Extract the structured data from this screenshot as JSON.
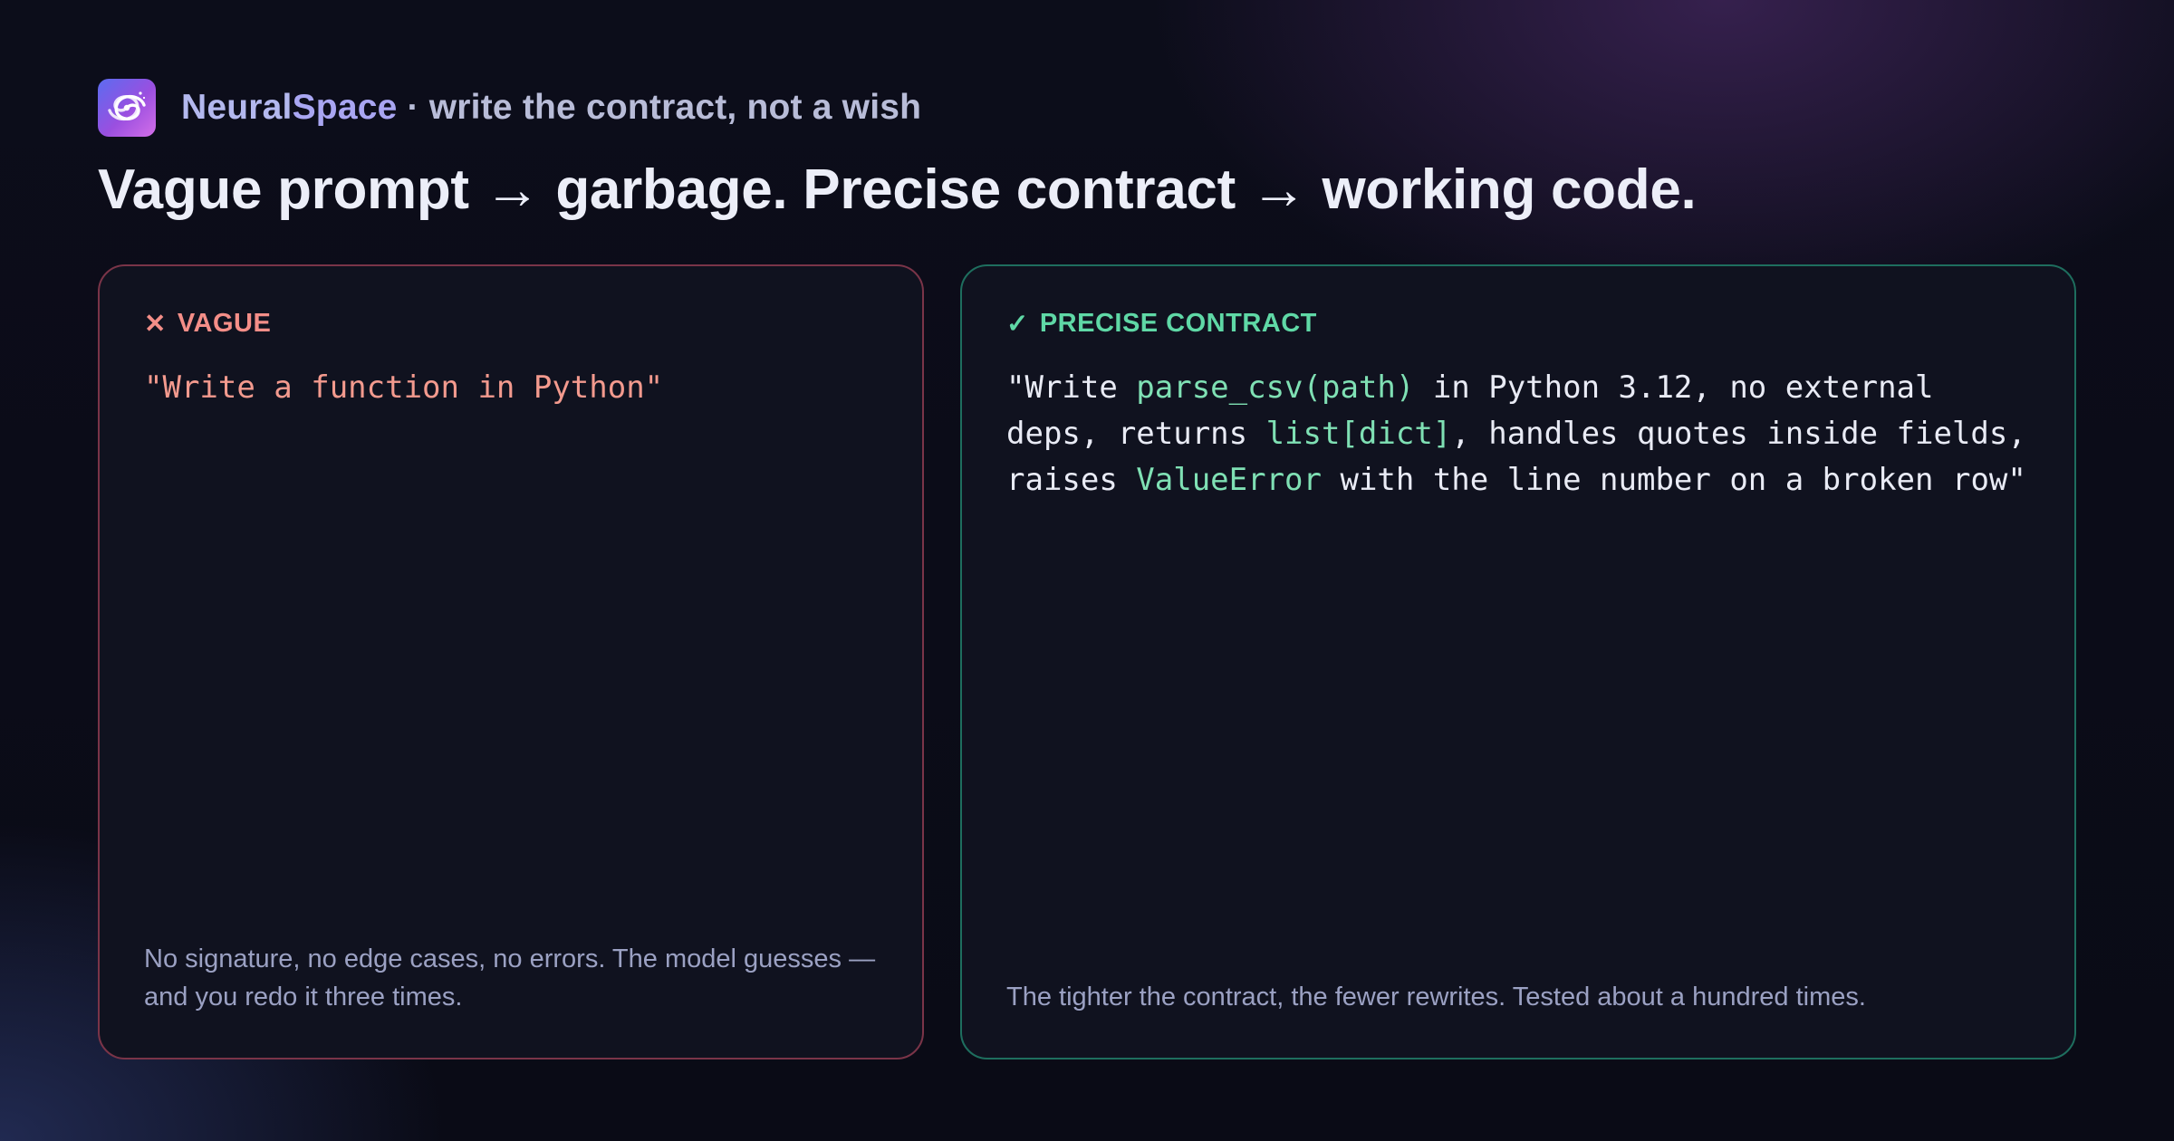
{
  "brand": {
    "name_part1": "Neural",
    "name_part2": "Space",
    "tagline": " · write the contract, not a wish",
    "logo_icon": "galaxy-swirl-icon"
  },
  "headline": "Vague prompt → garbage. Precise contract → working code.",
  "vague": {
    "mark": "✕",
    "label": "VAGUE",
    "prompt": "\"Write a function in Python\"",
    "note": "No signature, no edge cases, no errors. The model guesses — and you redo it three times.",
    "color": "#f48e88"
  },
  "precise": {
    "mark": "✓",
    "label": "PRECISE CONTRACT",
    "prompt_segments": [
      {
        "text": "\"Write ",
        "highlight": false
      },
      {
        "text": "parse_csv(path)",
        "highlight": true
      },
      {
        "text": " in Python 3.12, no external deps, returns ",
        "highlight": false
      },
      {
        "text": "list[dict]",
        "highlight": true
      },
      {
        "text": ", handles quotes inside fields, raises ",
        "highlight": false
      },
      {
        "text": "ValueError",
        "highlight": true
      },
      {
        "text": " with the line number on a broken row\"",
        "highlight": false
      }
    ],
    "note": "The tighter the contract, the fewer rewrites. Tested about a hundred times.",
    "color": "#5fd8a6"
  }
}
